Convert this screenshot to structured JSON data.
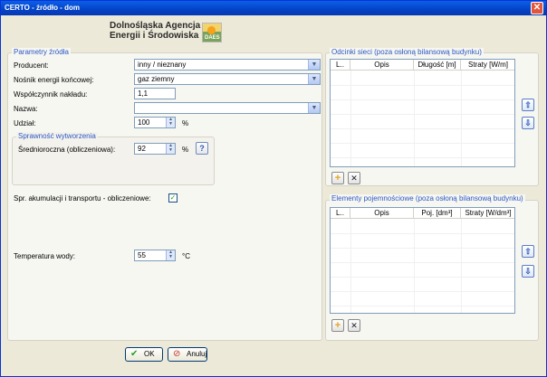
{
  "window": {
    "title": "CERTO - źródło - dom",
    "close_glyph": "✕"
  },
  "logo": {
    "line1": "Dolnośląska  Agencja",
    "line2": "Energii i Środowiska",
    "mark": "DAES"
  },
  "source_params": {
    "group_title": "Parametry źródła",
    "producer": {
      "label": "Producent:",
      "value": "inny / nieznany"
    },
    "energy_carrier": {
      "label": "Nośnik energii końcowej:",
      "value": "gaz ziemny"
    },
    "expenditure_factor": {
      "label": "Współczynnik nakładu:",
      "value": "1,1"
    },
    "name": {
      "label": "Nazwa:",
      "value": ""
    },
    "share": {
      "label": "Udział:",
      "value": "100",
      "unit": "%"
    }
  },
  "efficiency": {
    "group_title": "Sprawność wytworzenia",
    "annual_avg": {
      "label": "Średnioroczna (obliczeniowa):",
      "value": "92",
      "unit": "%"
    },
    "help_glyph": "?"
  },
  "storage": {
    "label": "Spr. akumulacji i transportu - obliczeniowe:",
    "checked": true,
    "check_glyph": "✓"
  },
  "water_temp": {
    "label": "Temperatura wody:",
    "value": "55",
    "unit": "°C"
  },
  "network_sections": {
    "group_title": "Odcinki sieci (poza osłoną bilansową budynku)",
    "columns": [
      "L..",
      "Opis",
      "Długość [m]",
      "Straty [W/m]"
    ]
  },
  "volume_elements": {
    "group_title": "Elementy pojemnościowe (poza osłoną bilansową budynku)",
    "columns": [
      "L..",
      "Opis",
      "Poj. [dm³]",
      "Straty [W/dm³]"
    ]
  },
  "buttons": {
    "ok": "OK",
    "cancel": "Anuluj",
    "add_glyph": "+",
    "delete_glyph": "✕",
    "up_glyph": "⇧",
    "down_glyph": "⇩"
  },
  "colors": {
    "title_bar": "#0A5FE6",
    "group_title": "#2D57C4",
    "check": "#21A121"
  }
}
